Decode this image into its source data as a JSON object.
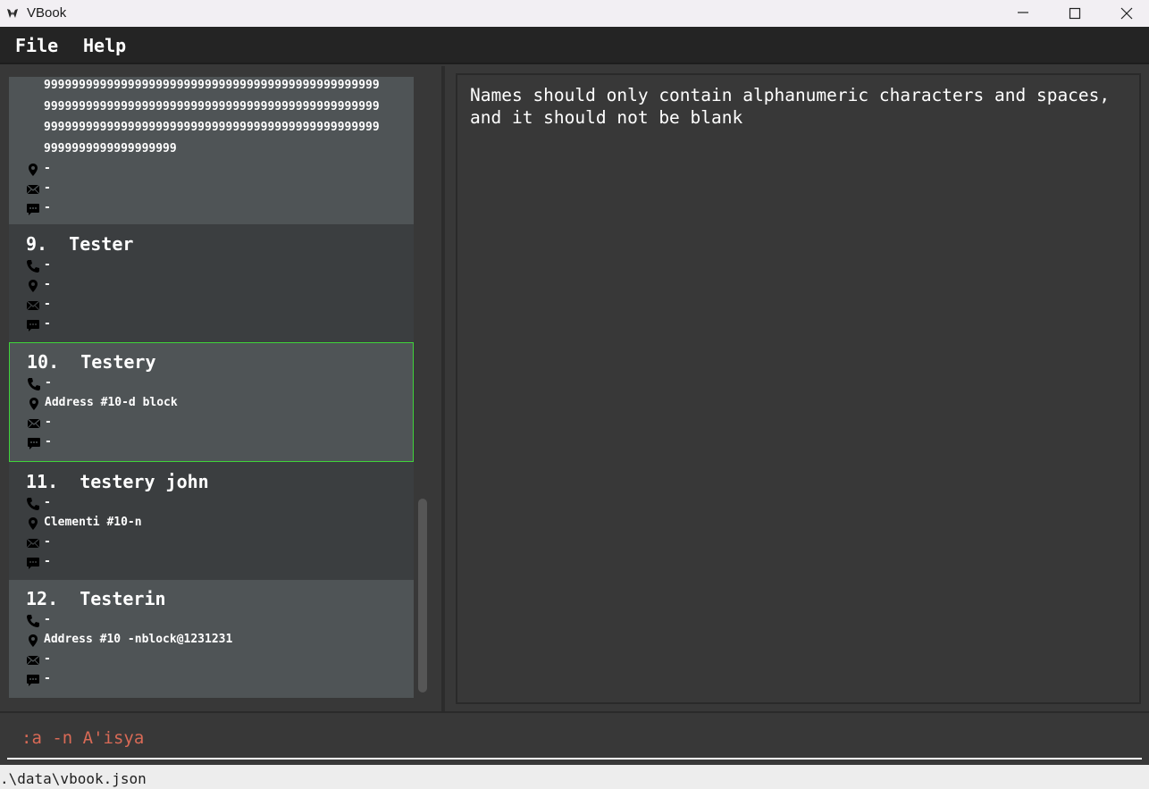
{
  "window": {
    "title": "VBook"
  },
  "menu": {
    "file": "File",
    "help": "Help"
  },
  "list": {
    "partial_card": {
      "nines_lines": [
        "999999999999999999999999999999999999999999999999",
        "999999999999999999999999999999999999999999999999",
        "999999999999999999999999999999999999999999999999",
        "9999999999999999999"
      ],
      "address": "-",
      "email": "-",
      "remark": "-"
    },
    "cards": [
      {
        "name": "9.  Tester",
        "phone": "-",
        "address": "-",
        "email": "-",
        "remark": "-"
      },
      {
        "name": "10.  Testery",
        "phone": "-",
        "address": "Address #10-d block",
        "email": "-",
        "remark": "-"
      },
      {
        "name": "11.  testery john",
        "phone": "-",
        "address": "Clementi #10-n",
        "email": "-",
        "remark": "-"
      },
      {
        "name": "12.  Testerin",
        "phone": "-",
        "address": "Address #10 -nblock@1231231",
        "email": "-",
        "remark": "-"
      }
    ]
  },
  "detail": {
    "message": "Names should only contain alphanumeric characters and spaces, and it should not be blank"
  },
  "command": {
    "value": ":a -n A'isya"
  },
  "status": {
    "file_path": ".\\data\\vbook.json"
  },
  "colors": {
    "selected_border": "#3fd43a",
    "command_text": "#d96a56",
    "card_alt": "#4f5456",
    "card_dark": "#3b3e40"
  }
}
